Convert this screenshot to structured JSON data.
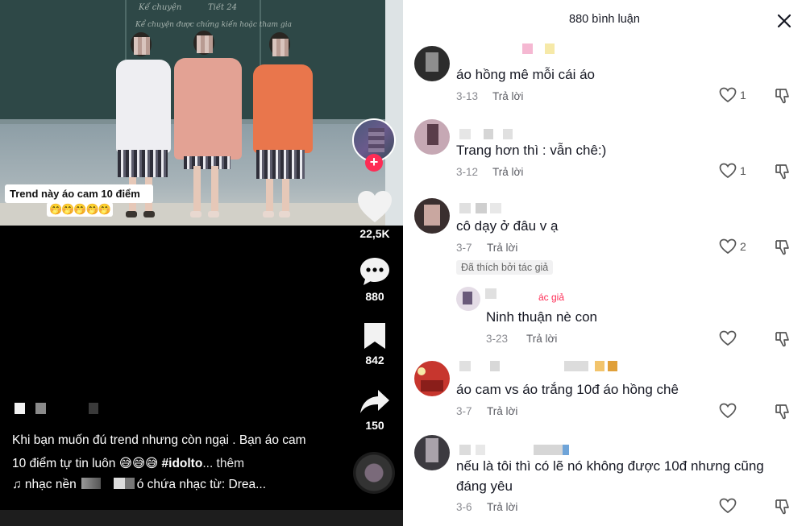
{
  "video": {
    "blackboard_text": [
      "Kể chuyện",
      "Tiết 24",
      "Kể chuyện được chứng kiến hoặc tham gia"
    ],
    "caption_line1": "Trend này áo cam 10 điểm",
    "caption_emoji": "🤭🤭🤭🤭🤭",
    "actions": {
      "likes": "22,5K",
      "comments": "880",
      "saves": "842",
      "shares": "150"
    },
    "description": {
      "text": "Khi bạn muốn đú trend nhưng còn ngại . Bạn áo cam 10 điểm tự tin luôn 😅😅😅",
      "hashtag": "#idolto",
      "more": "... thêm"
    },
    "music": {
      "prefix": "♫ nhạc nền",
      "suffix": "ó chứa nhạc từ: Drea..."
    },
    "icons": {
      "like": "heart-icon",
      "comment": "comment-bubble-icon",
      "save": "bookmark-icon",
      "share": "share-arrow-icon",
      "music": "music-note-icon",
      "follow": "plus-icon"
    }
  },
  "comments_panel": {
    "header": "880 bình luận",
    "close_icon": "close-icon",
    "reply_label": "Trả lời",
    "author_label": "ác giả",
    "liked_by_author": "Đã thích bởi tác giả",
    "comments": [
      {
        "text": "áo hồng mê mỗi cái áo",
        "date": "3-13",
        "likes": "1"
      },
      {
        "text": "Trang hơn thì : vẫn chê:)",
        "date": "3-12",
        "likes": "1"
      },
      {
        "text": "cô dạy ở đâu v ạ",
        "date": "3-7",
        "likes": "2"
      },
      {
        "text": "Ninh thuận nè con",
        "date": "3-23",
        "likes": ""
      },
      {
        "text": "áo cam vs áo trắng 10đ áo hồng chê",
        "date": "3-7",
        "likes": ""
      },
      {
        "text": "nếu là tôi thì có lẽ nó không được 10đ nhưng cũng đáng yêu",
        "date": "3-6",
        "likes": ""
      }
    ]
  },
  "colors": {
    "accent": "#fe2c55",
    "text_primary": "#161823",
    "text_secondary": "#8a8b91"
  }
}
